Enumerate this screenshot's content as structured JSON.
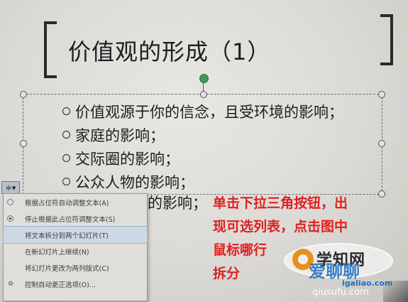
{
  "slide": {
    "title": "价值观的形成（1）",
    "bullets": [
      "价值观源于你的信念，且受环境的影响；",
      "家庭的影响；",
      "交际圈的影响；",
      "公众人物的影响；"
    ],
    "partial_line": "的影响；"
  },
  "autofit_button": {
    "label": "≑▾"
  },
  "autofit_menu": {
    "items": [
      {
        "label": "根据占位符自动调整文本(A)",
        "selected": false
      },
      {
        "label": "停止根据此占位符调整文本(S)",
        "selected": true
      },
      {
        "label": "将文本拆分到两个幻灯片(T)",
        "highlighted": true
      },
      {
        "label": "在新幻灯片上继续(N)"
      },
      {
        "label": "将幻灯片更改为两列版式(C)"
      },
      {
        "label": "控制自动更正选项(O)..."
      }
    ]
  },
  "annotation": {
    "lines": [
      "单击下拉三角按钮，出",
      "现可选列表，点击图中",
      "鼠标哪行",
      "拆分"
    ]
  },
  "watermark": {
    "text": "学知网",
    "text2": "爱聊聊",
    "url": "igaliao.com",
    "url2": "qiusufu.com"
  },
  "colors": {
    "annotation": "#e02020",
    "rotate_handle": "#3c9c5a",
    "watermark_blue": "#1f6fc0"
  }
}
